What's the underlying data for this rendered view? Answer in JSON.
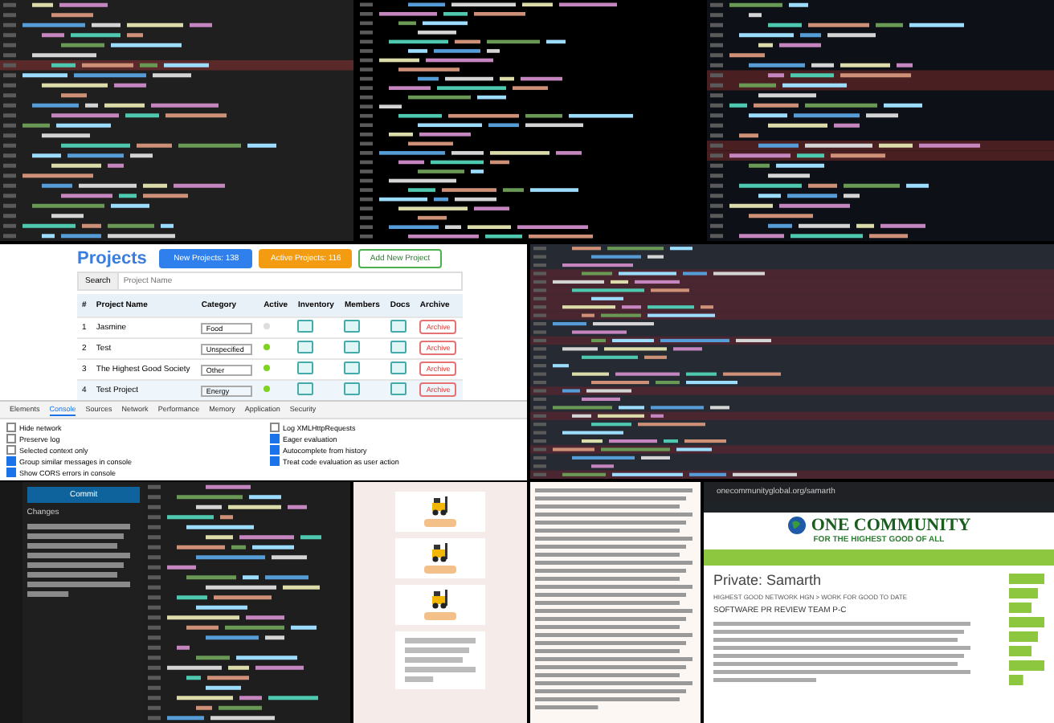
{
  "projects_page": {
    "title": "Projects",
    "buttons": [
      {
        "label": "New Projects: 138",
        "kind": "primary"
      },
      {
        "label": "Active Projects: 116",
        "kind": "warning"
      },
      {
        "label": "Add New Project",
        "kind": "outline"
      }
    ],
    "search": {
      "label": "Search",
      "placeholder": "Project Name"
    },
    "columns": [
      "#",
      "Project Name",
      "Category",
      "Active",
      "Inventory",
      "Members",
      "Docs",
      "Archive"
    ],
    "rows": [
      {
        "number": "1",
        "name": "Jasmine",
        "category": "Food",
        "active": false,
        "selected": false,
        "archive": "Archive"
      },
      {
        "number": "2",
        "name": "Test",
        "category": "Unspecified",
        "active": true,
        "selected": false,
        "archive": "Archive"
      },
      {
        "number": "3",
        "name": "The Highest Good Society",
        "category": "Other",
        "active": true,
        "selected": false,
        "archive": "Archive"
      },
      {
        "number": "4",
        "name": "Test Project",
        "category": "Energy",
        "active": true,
        "selected": true,
        "archive": "Archive"
      }
    ]
  },
  "devtools": {
    "tabs": [
      {
        "label": "Elements",
        "selected": false
      },
      {
        "label": "Console",
        "selected": true
      },
      {
        "label": "Sources",
        "selected": false
      },
      {
        "label": "Network",
        "selected": false
      },
      {
        "label": "Performance",
        "selected": false
      },
      {
        "label": "Memory",
        "selected": false
      },
      {
        "label": "Application",
        "selected": false
      },
      {
        "label": "Security",
        "selected": false
      }
    ],
    "settings": [
      {
        "label": "Hide network",
        "checked": false
      },
      {
        "label": "Log XMLHttpRequests",
        "checked": false
      },
      {
        "label": "Preserve log",
        "checked": false
      },
      {
        "label": "Eager evaluation",
        "checked": true
      },
      {
        "label": "Selected context only",
        "checked": false
      },
      {
        "label": "Autocomplete from history",
        "checked": true
      },
      {
        "label": "Group similar messages in console",
        "checked": true
      },
      {
        "label": "Treat code evaluation as user action",
        "checked": true
      },
      {
        "label": "Show CORS errors in console",
        "checked": true
      }
    ]
  },
  "source_control": {
    "commit_button": "Commit",
    "changes_label": "Changes"
  },
  "web_page": {
    "address": "onecommunityglobal.org/samarth",
    "logo": "ONE COMMUNITY",
    "tagline": "FOR THE HIGHEST GOOD OF ALL",
    "heading": "Private: Samarth",
    "breadcrumb": "HIGHEST GOOD NETWORK HGN > WORK FOR GOOD TO DATE",
    "subheading": "SOFTWARE PR REVIEW TEAM P-C"
  }
}
